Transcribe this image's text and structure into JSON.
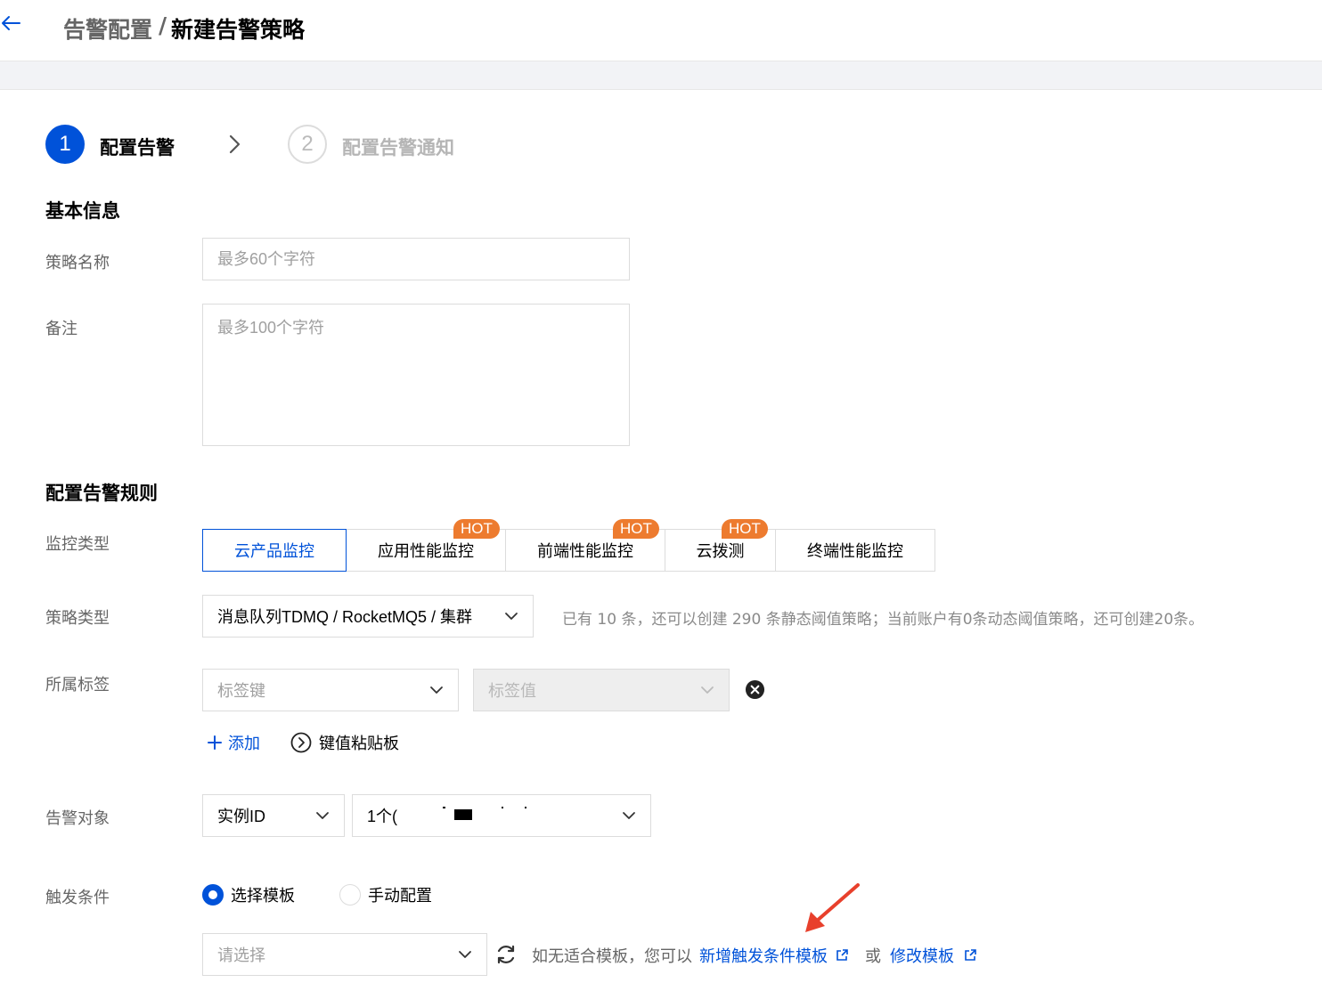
{
  "header": {
    "breadcrumb_parent": "告警配置",
    "breadcrumb_separator": "/",
    "breadcrumb_current": "新建告警策略"
  },
  "steps": [
    {
      "number": "1",
      "label": "配置告警",
      "active": true
    },
    {
      "number": "2",
      "label": "配置告警通知",
      "active": false
    }
  ],
  "basic_info": {
    "title": "基本信息",
    "name_label": "策略名称",
    "name_placeholder": "最多60个字符",
    "remark_label": "备注",
    "remark_placeholder": "最多100个字符"
  },
  "rules": {
    "title": "配置告警规则",
    "monitor_type_label": "监控类型",
    "monitor_types": [
      {
        "label": "云产品监控",
        "active": true,
        "hot": ""
      },
      {
        "label": "应用性能监控",
        "active": false,
        "hot": "HOT"
      },
      {
        "label": "前端性能监控",
        "active": false,
        "hot": "HOT"
      },
      {
        "label": "云拨测",
        "active": false,
        "hot": "HOT"
      },
      {
        "label": "终端性能监控",
        "active": false,
        "hot": ""
      }
    ],
    "policy_type_label": "策略类型",
    "policy_type_value": "消息队列TDMQ / RocketMQ5 / 集群",
    "policy_quota_hint": "已有 10 条，还可以创建 290 条静态阈值策略；当前账户有0条动态阈值策略，还可创建20条。",
    "tag_label": "所属标签",
    "tag_key_placeholder": "标签键",
    "tag_value_placeholder": "标签值",
    "add_label": "添加",
    "clipboard_label": "键值粘贴板",
    "target_label": "告警对象",
    "target_type_value": "实例ID",
    "target_instance_value": "1个(",
    "trigger_label": "触发条件",
    "trigger_options": [
      {
        "label": "选择模板",
        "checked": true
      },
      {
        "label": "手动配置",
        "checked": false
      }
    ],
    "template_placeholder": "请选择",
    "template_hint": "如无适合模板，您可以",
    "new_template_link": "新增触发条件模板",
    "or_text": "或",
    "edit_template_link": "修改模板"
  },
  "colors": {
    "primary": "#0052d9",
    "hot_badge": "#ed7b2f",
    "annotation_arrow": "#e8402c"
  }
}
